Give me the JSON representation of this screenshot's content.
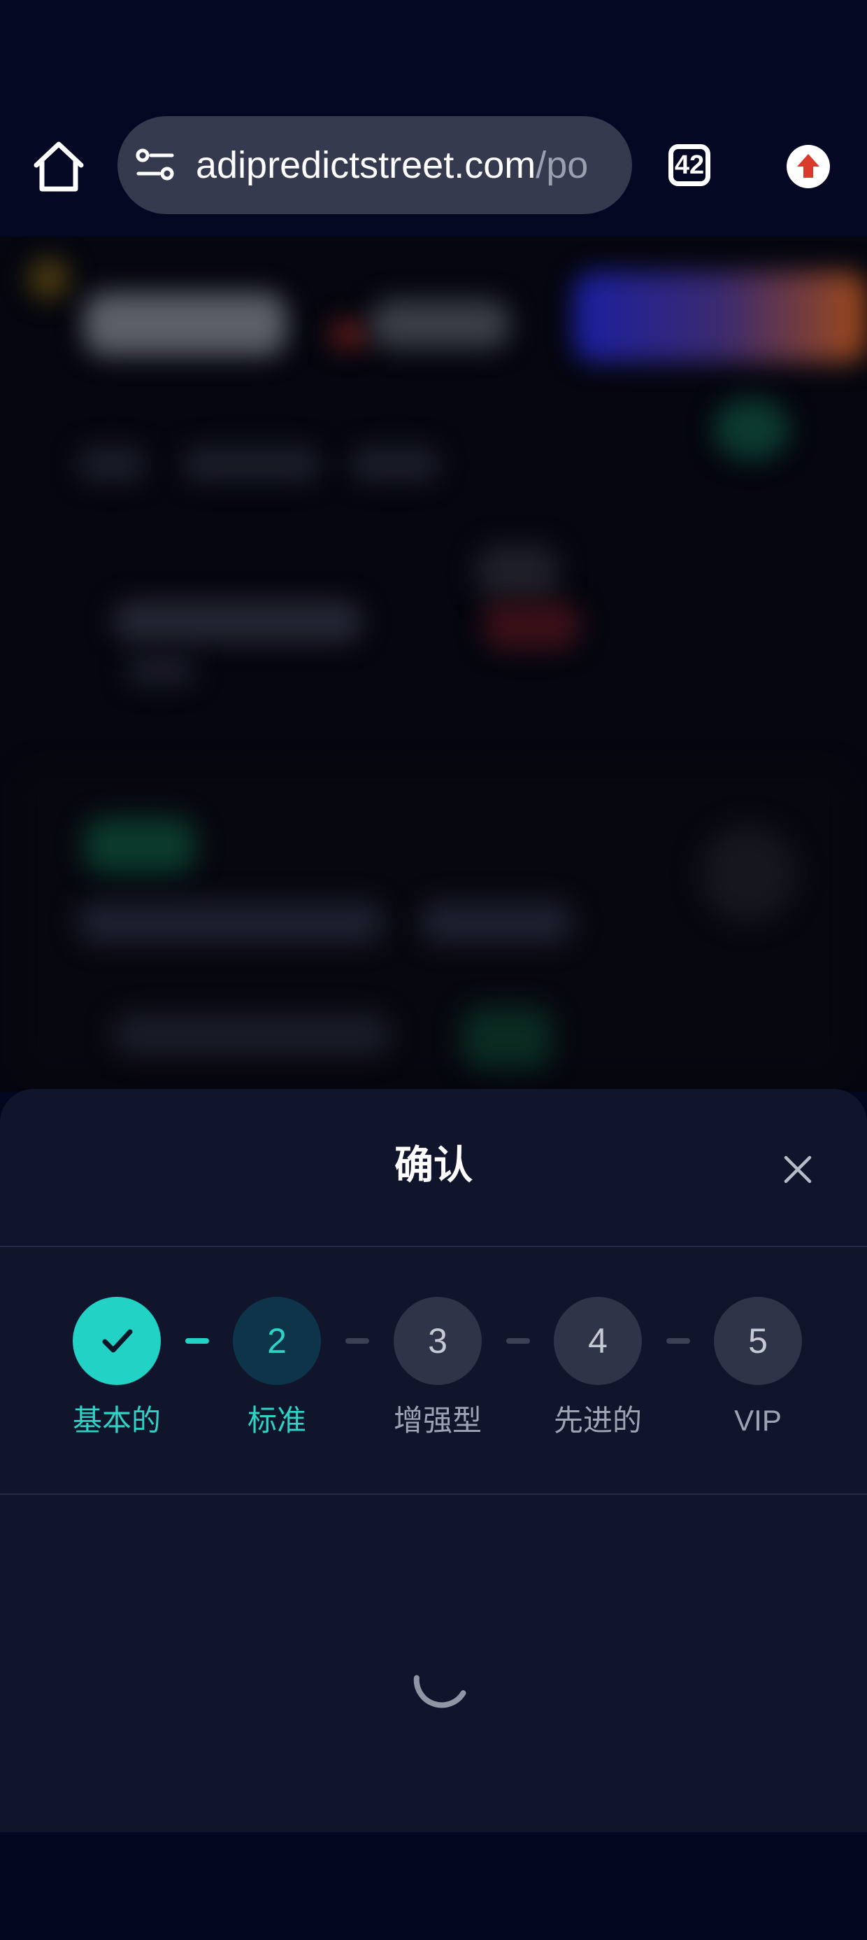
{
  "browser": {
    "url_main": "adipredictstreet.com",
    "url_rest": "/po",
    "tab_count": "42"
  },
  "dialog": {
    "title": "确认",
    "steps": [
      {
        "number": "1",
        "label": "基本的",
        "state": "completed"
      },
      {
        "number": "2",
        "label": "标准",
        "state": "current"
      },
      {
        "number": "3",
        "label": "增强型",
        "state": "upcoming"
      },
      {
        "number": "4",
        "label": "先进的",
        "state": "upcoming"
      },
      {
        "number": "5",
        "label": "VIP",
        "state": "upcoming"
      }
    ]
  },
  "colors": {
    "accent": "#22d3c5",
    "sheet_background": "#10152c",
    "page_background": "#030720"
  },
  "icons": [
    "home-icon",
    "site-settings-icon",
    "tab-switcher-icon",
    "update-icon",
    "close-icon",
    "check-icon",
    "loading-spinner"
  ]
}
